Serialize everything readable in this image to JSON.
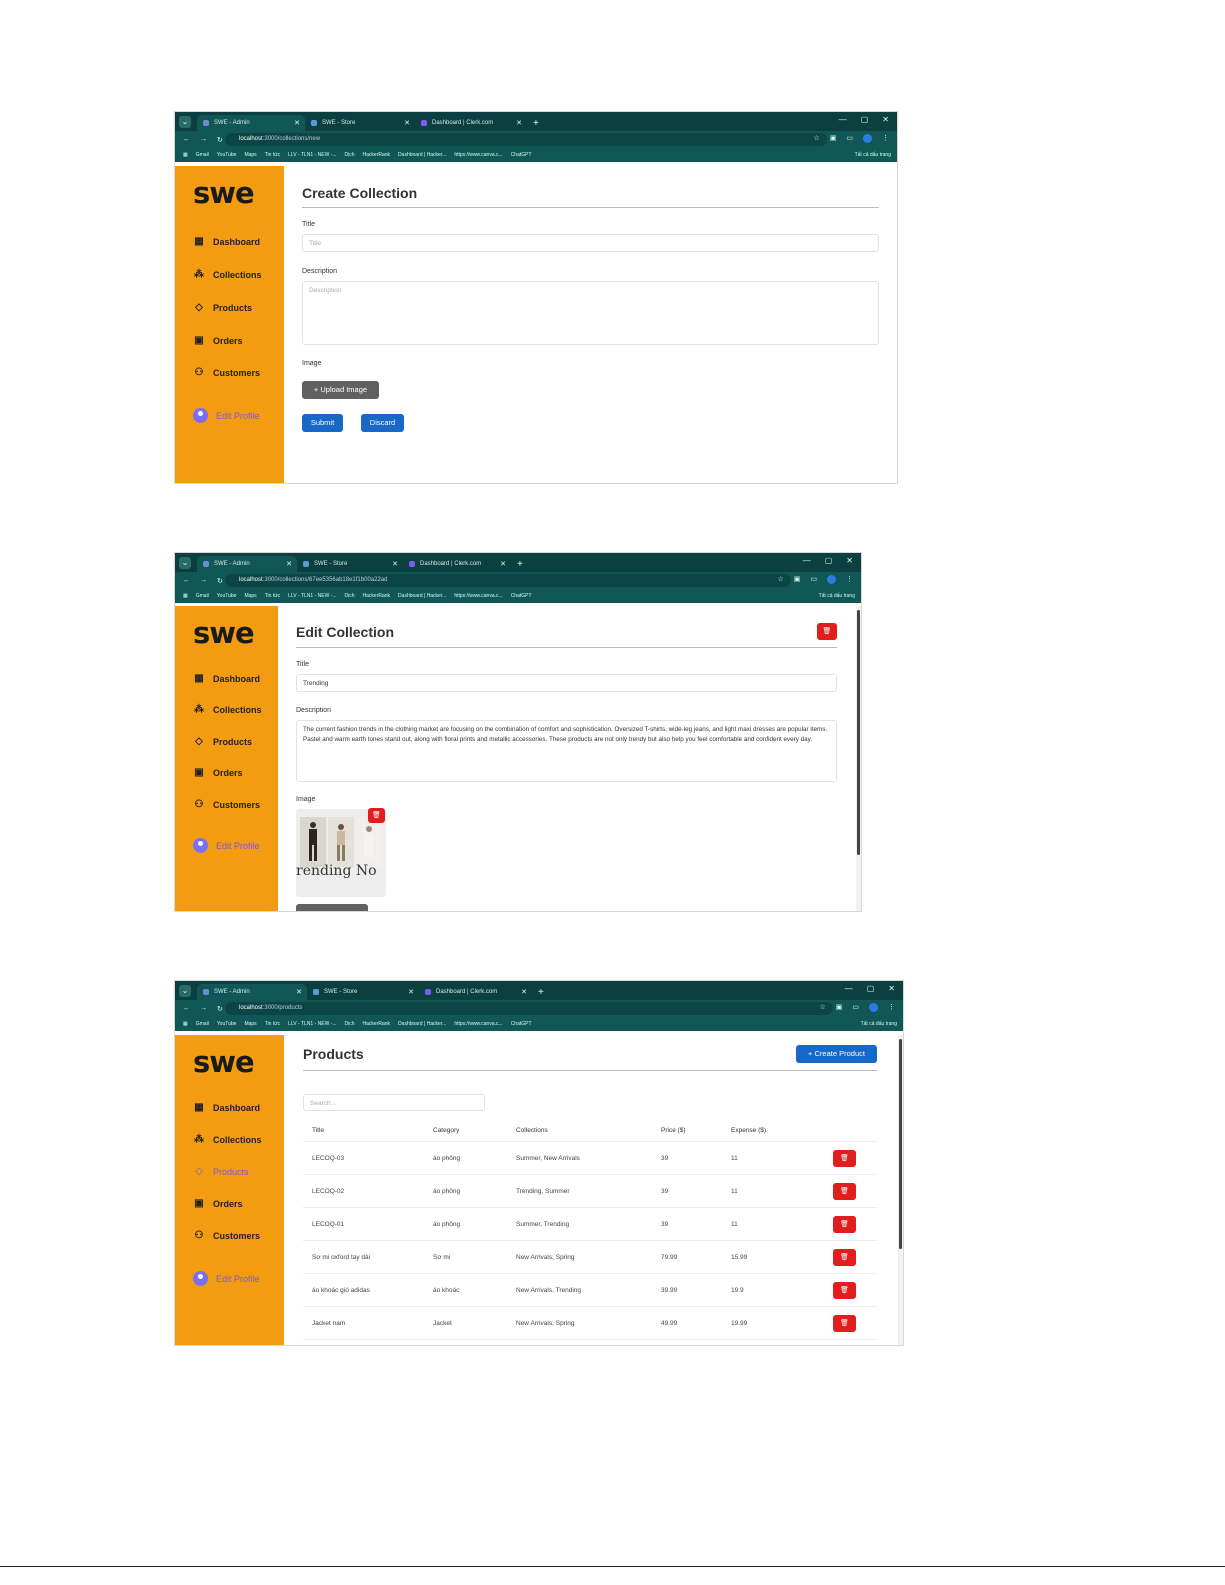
{
  "browser": {
    "tabs": [
      {
        "title": "SWE - Admin",
        "active": true
      },
      {
        "title": "SWE - Store",
        "active": false
      },
      {
        "title": "Dashboard | Clerk.com",
        "active": false
      }
    ],
    "bookmarks": [
      "Gmail",
      "YouTube",
      "Maps",
      "Tin tức",
      "LLV - TLN1 - NEW -...",
      "Dịch",
      "HackerRank",
      "Dashboard | Hacker...",
      "https://www.canva.c...",
      "ChatGPT"
    ],
    "all_bookmarks": "Tất cả dấu trang"
  },
  "sidebar": {
    "logo": "swe",
    "items": [
      {
        "label": "Dashboard",
        "icon": "dashboard-icon"
      },
      {
        "label": "Collections",
        "icon": "shapes-icon"
      },
      {
        "label": "Products",
        "icon": "tag-icon"
      },
      {
        "label": "Orders",
        "icon": "shopping-bag-icon"
      },
      {
        "label": "Customers",
        "icon": "users-icon"
      }
    ],
    "profile_label": "Edit Profile"
  },
  "screen1": {
    "url_host": "localhost",
    "url_rest": ":3000/collections/new",
    "title": "Create Collection",
    "title_label": "Title",
    "title_placeholder": "Title",
    "description_label": "Description",
    "description_placeholder": "Description",
    "image_label": "Image",
    "upload_button": "+ Upload Image",
    "submit_button": "Submit",
    "discard_button": "Discard"
  },
  "screen2": {
    "url_host": "localhost",
    "url_rest": ":3000/collections/67ee5356ab18e1f1b00a22ad",
    "title": "Edit Collection",
    "title_label": "Title",
    "title_value": "Trending",
    "description_label": "Description",
    "description_value": "The current fashion trends in the clothing market are focusing on the combination of comfort and sophistication. Oversized T-shirts, wide-leg jeans, and light maxi dresses are popular items. Pastel and warm earth tones stand out, along with floral prints and metallic accessories. These products are not only trendy but also help you feel comfortable and confident every day.",
    "image_label": "Image",
    "image_caption": "rending No"
  },
  "screen3": {
    "url_host": "localhost",
    "url_rest": ":3000/products",
    "title": "Products",
    "create_button": "+ Create Product",
    "search_placeholder": "Search...",
    "columns": [
      "Title",
      "Category",
      "Collections",
      "Price ($)",
      "Expense ($)"
    ],
    "rows": [
      {
        "title": "LECOQ-03",
        "category": "áo phông",
        "collections": "Summer, New Arrivals",
        "price": "39",
        "expense": "11"
      },
      {
        "title": "LECOQ-02",
        "category": "áo phông",
        "collections": "Trending, Summer",
        "price": "39",
        "expense": "11"
      },
      {
        "title": "LECOQ-01",
        "category": "áo phông",
        "collections": "Summer, Trending",
        "price": "39",
        "expense": "11"
      },
      {
        "title": "Sơ mi oxford tay dài",
        "category": "Sơ mi",
        "collections": "New Arrivals, Spring",
        "price": "79.99",
        "expense": "15.99"
      },
      {
        "title": "áo khoác gió adidas",
        "category": "áo khoác",
        "collections": "New Arrivals, Trending",
        "price": "39.99",
        "expense": "19.9"
      },
      {
        "title": "Jacket nam",
        "category": "Jacket",
        "collections": "New Arrivals, Spring",
        "price": "49.99",
        "expense": "19.99"
      }
    ]
  }
}
